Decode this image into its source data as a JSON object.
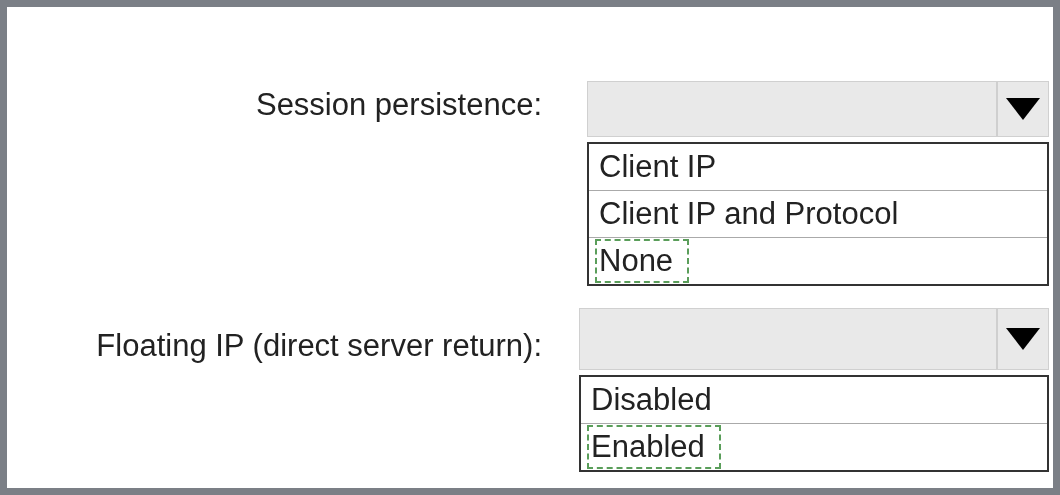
{
  "fields": [
    {
      "label": "Session persistence:",
      "options": [
        {
          "label": "Client IP",
          "selected": false
        },
        {
          "label": "Client IP and Protocol",
          "selected": false
        },
        {
          "label": "None",
          "selected": true
        }
      ]
    },
    {
      "label": "Floating IP (direct server return):",
      "options": [
        {
          "label": "Disabled",
          "selected": false
        },
        {
          "label": "Enabled",
          "selected": true
        }
      ]
    }
  ]
}
